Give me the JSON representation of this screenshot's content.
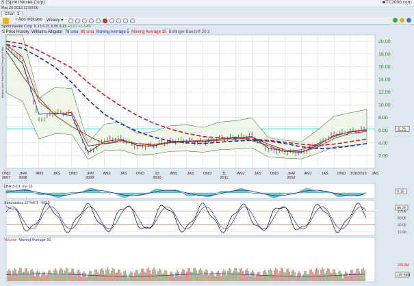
{
  "window": {
    "title": "S (Sprint Nextel Corp)",
    "datetime": "Mar 28 2013 12:00:00",
    "brand": "TC2000.com",
    "tab_label": "Chart_3"
  },
  "toolbar": {
    "add_indicator_label": "Add Indicator",
    "period_label": "Weekly",
    "period_caret": "▾"
  },
  "quote": {
    "name": "Sprint Nextel Corp",
    "open": "6.15",
    "high": "6.21",
    "low": "6.00",
    "last": "6.21",
    "change": "+0.07",
    "change_pct": "+1.14%"
  },
  "legend": {
    "symbol": "S",
    "price_history": "Price History",
    "alligator": "Williams Alligator",
    "sma79": "79 sma",
    "sma89": "89 sma",
    "ma5": "Moving Average 5",
    "ma15": "Moving Average 15",
    "bollinger": "Bollinger Bands® 20 2"
  },
  "colors": {
    "sma79": "#1a2e9a",
    "sma89": "#c21e1e",
    "ma5": "#1a2e9a",
    "ma15": "#c21e1e",
    "bollinger": "#3a6a3a",
    "up": "#2e8b2e",
    "down": "#d22",
    "grid": "#c9d4de",
    "price_axis": "#2e8b2e",
    "baseline": "#3cc6c6"
  },
  "sidebar_text": "Bearish Alert Ratio  Bullish Divergence Bar",
  "price_axis": {
    "ticks": [
      "20.00",
      "18.00",
      "16.00",
      "14.00",
      "12.00",
      "10.00",
      "8.00",
      "6.00",
      "4.00",
      "2.00"
    ],
    "last_marker": "6.21"
  },
  "time_axis": {
    "labels": [
      {
        "label": "OND",
        "sub": "2007"
      },
      {
        "label": "JFM",
        "sub": "2008"
      },
      {
        "label": "AMJ",
        "sub": ""
      },
      {
        "label": "JAS",
        "sub": ""
      },
      {
        "label": "OND",
        "sub": ""
      },
      {
        "label": "JFM",
        "sub": "2009"
      },
      {
        "label": "AMJ",
        "sub": ""
      },
      {
        "label": "JAS",
        "sub": ""
      },
      {
        "label": "OND",
        "sub": ""
      },
      {
        "label": "10",
        "sub": "2010"
      },
      {
        "label": "AMJ",
        "sub": ""
      },
      {
        "label": "JAS",
        "sub": ""
      },
      {
        "label": "OND",
        "sub": ""
      },
      {
        "label": "11",
        "sub": "2011"
      },
      {
        "label": "AMJ",
        "sub": ""
      },
      {
        "label": "JAS",
        "sub": ""
      },
      {
        "label": "OND",
        "sub": ""
      },
      {
        "label": "JFM",
        "sub": "2012"
      },
      {
        "label": "AMJ",
        "sub": ""
      },
      {
        "label": "JAS",
        "sub": ""
      },
      {
        "label": "OND",
        "sub": ""
      },
      {
        "label": "3/28/2013",
        "sub": ""
      },
      {
        "label": "JAS",
        "sub": ""
      }
    ]
  },
  "panes": {
    "lbr": {
      "label": "LBR 3-10",
      "ma_label": "ma 16",
      "last": "0.15"
    },
    "stoch": {
      "label": "Stochastics 12 %K 3",
      "d_label": "%D 5",
      "last": "86.26",
      "ticks": [
        "70.00",
        "50.00",
        "30.00",
        "10.00"
      ]
    },
    "volume": {
      "label": "Volume",
      "ma_label": "Moving Average 50",
      "last": "100.56M",
      "tick": "200.0M"
    }
  },
  "chart_data": {
    "type": "line",
    "title": "S (Sprint Nextel Corp)",
    "xlabel": "",
    "ylabel": "",
    "x": [
      "2007-10",
      "2008-01",
      "2008-04",
      "2008-07",
      "2008-10",
      "2009-01",
      "2009-04",
      "2009-07",
      "2009-10",
      "2010-01",
      "2010-04",
      "2010-07",
      "2010-10",
      "2011-01",
      "2011-04",
      "2011-07",
      "2011-10",
      "2012-01",
      "2012-04",
      "2012-07",
      "2012-10",
      "2013-01",
      "2013-03"
    ],
    "series": [
      {
        "name": "Price History",
        "values": [
          19.2,
          17.0,
          7.5,
          8.8,
          8.6,
          2.3,
          4.5,
          4.7,
          3.4,
          3.6,
          4.3,
          4.4,
          4.1,
          4.7,
          4.9,
          5.2,
          2.9,
          2.6,
          2.4,
          3.8,
          5.4,
          5.8,
          6.21
        ]
      },
      {
        "name": "79 sma",
        "values": [
          19.5,
          18.9,
          17.5,
          15.9,
          13.5,
          10.8,
          8.5,
          7.0,
          5.8,
          4.9,
          4.3,
          4.0,
          3.9,
          4.1,
          4.3,
          4.4,
          4.3,
          3.9,
          3.4,
          3.1,
          3.2,
          3.5,
          3.9
        ]
      },
      {
        "name": "89 sma",
        "values": [
          20.0,
          19.6,
          18.5,
          17.2,
          15.8,
          13.5,
          11.5,
          9.8,
          8.3,
          7.1,
          6.2,
          5.5,
          5.0,
          4.8,
          4.7,
          4.6,
          4.4,
          4.1,
          3.8,
          3.6,
          3.8,
          4.2,
          4.6
        ]
      },
      {
        "name": "Moving Average 5",
        "values": [
          19.0,
          16.5,
          8.5,
          8.7,
          8.3,
          2.5,
          4.2,
          4.6,
          3.6,
          3.5,
          4.2,
          4.3,
          4.2,
          4.6,
          4.8,
          5.0,
          3.2,
          2.7,
          2.5,
          3.6,
          5.2,
          5.7,
          6.0
        ]
      },
      {
        "name": "Moving Average 15",
        "values": [
          19.5,
          17.5,
          10.5,
          8.5,
          8.8,
          3.5,
          3.9,
          4.4,
          3.9,
          3.6,
          4.0,
          4.2,
          4.2,
          4.4,
          4.6,
          4.9,
          3.8,
          2.9,
          2.6,
          3.3,
          4.7,
          5.5,
          5.8
        ]
      }
    ],
    "ylim": [
      0,
      21
    ]
  }
}
